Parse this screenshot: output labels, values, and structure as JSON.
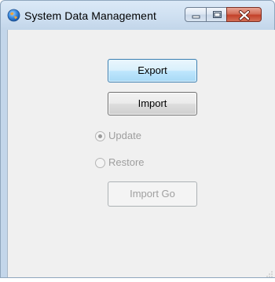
{
  "window": {
    "title": "System Data Management",
    "icon": "app-globe-icon",
    "caption_buttons": [
      "minimize-icon",
      "maximize-icon",
      "close-icon"
    ]
  },
  "actions": {
    "export_label": "Export",
    "import_label": "Import",
    "import_go_label": "Import Go"
  },
  "import_mode": {
    "options": [
      {
        "label": "Update",
        "selected": true,
        "enabled": false
      },
      {
        "label": "Restore",
        "selected": false,
        "enabled": false
      }
    ]
  },
  "colors": {
    "export_focus_border": "#3c7fb1",
    "close_button": "#c3412a",
    "disabled_text": "#a0a0a0"
  }
}
